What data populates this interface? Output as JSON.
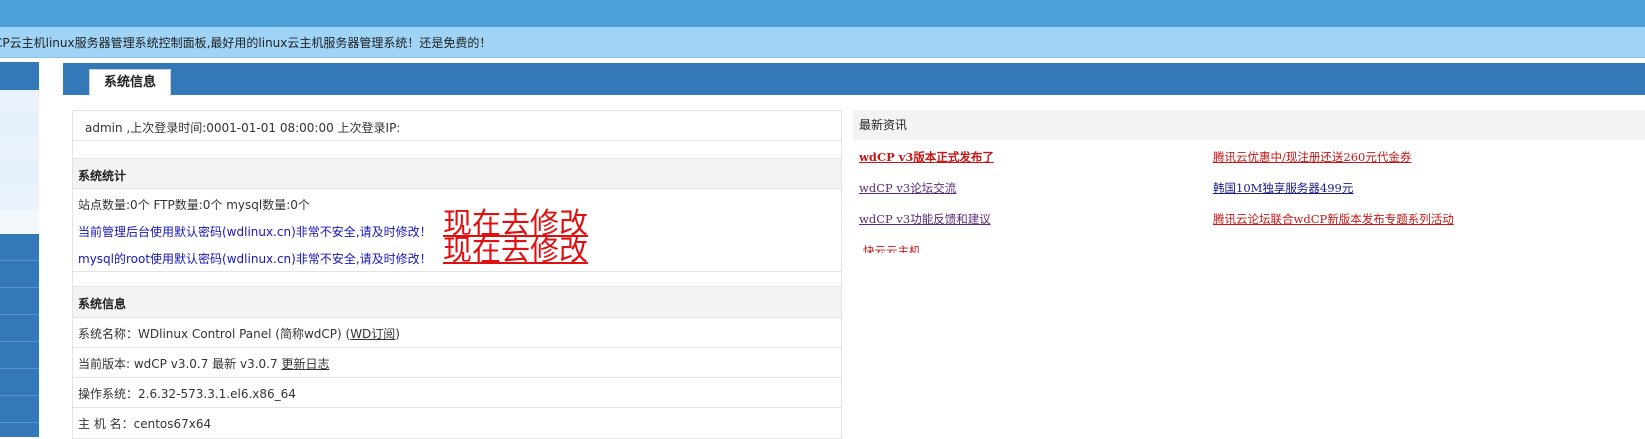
{
  "notice": "CP云主机linux服务器管理系统控制面板,最好用的linux云主机服务器管理系统！还是免费的！",
  "section_tab": "系统信息",
  "login_info": "admin ,上次登录时间:0001-01-01 08:00:00 上次登录IP:",
  "stats": {
    "heading": "系统统计",
    "counts": "站点数量:0个  FTP数量:0个  mysql数量:0个",
    "warn_admin": "当前管理后台使用默认密码(wdlinux.cn)非常不安全,请及时修改！",
    "warn_mysql": "mysql的root使用默认密码(wdlinux.cn)非常不安全,请及时修改！",
    "fix_link": "现在去修改"
  },
  "sysinfo": {
    "heading": "系统信息",
    "name_label": "系统名称：WDlinux Control Panel (简称wdCP) (",
    "name_link": "WD订阅",
    "name_suffix": ")",
    "version_label": "当前版本: wdCP v3.0.7 最新 v3.0.7 ",
    "changelog_link": "更新日志",
    "os_label": "操作系统：2.6.32-573.3.1.el6.x86_64",
    "host_partial": "主 机 名：centos67x64"
  },
  "news": {
    "heading": "最新资讯",
    "items": [
      {
        "text": "wdCP v3版本正式发布了",
        "color": "#c81616"
      },
      {
        "text": "腾讯云优惠中/现注册还送260元代金券",
        "color": "#c81616"
      },
      {
        "text": "wdCP v3论坛交流",
        "color": "#5a2a7a"
      },
      {
        "text": "韩国10M独享服务器499元",
        "color": "#1a1a8c"
      },
      {
        "text": "wdCP v3功能反馈和建议",
        "color": "#5a2a7a"
      },
      {
        "text": "腾讯云论坛联合wdCP新版本发布专题系列活动",
        "color": "#c81616"
      },
      {
        "text": "快云云主机",
        "color": "#c81616"
      }
    ]
  }
}
